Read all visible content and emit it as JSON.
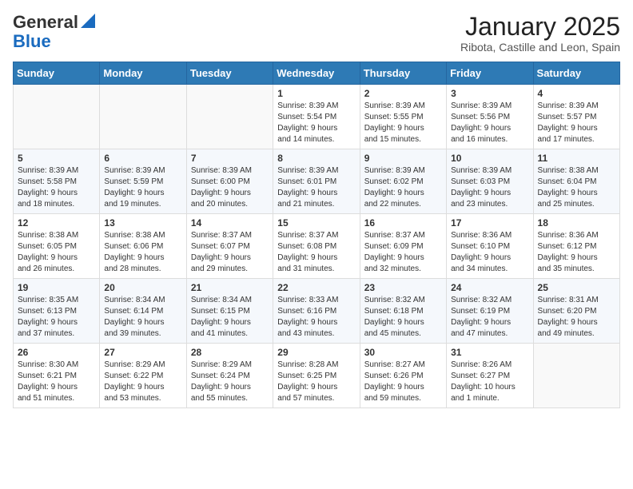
{
  "logo": {
    "general": "General",
    "blue": "Blue"
  },
  "title": "January 2025",
  "subtitle": "Ribota, Castille and Leon, Spain",
  "headers": [
    "Sunday",
    "Monday",
    "Tuesday",
    "Wednesday",
    "Thursday",
    "Friday",
    "Saturday"
  ],
  "weeks": [
    [
      {
        "day": "",
        "info": ""
      },
      {
        "day": "",
        "info": ""
      },
      {
        "day": "",
        "info": ""
      },
      {
        "day": "1",
        "info": "Sunrise: 8:39 AM\nSunset: 5:54 PM\nDaylight: 9 hours\nand 14 minutes."
      },
      {
        "day": "2",
        "info": "Sunrise: 8:39 AM\nSunset: 5:55 PM\nDaylight: 9 hours\nand 15 minutes."
      },
      {
        "day": "3",
        "info": "Sunrise: 8:39 AM\nSunset: 5:56 PM\nDaylight: 9 hours\nand 16 minutes."
      },
      {
        "day": "4",
        "info": "Sunrise: 8:39 AM\nSunset: 5:57 PM\nDaylight: 9 hours\nand 17 minutes."
      }
    ],
    [
      {
        "day": "5",
        "info": "Sunrise: 8:39 AM\nSunset: 5:58 PM\nDaylight: 9 hours\nand 18 minutes."
      },
      {
        "day": "6",
        "info": "Sunrise: 8:39 AM\nSunset: 5:59 PM\nDaylight: 9 hours\nand 19 minutes."
      },
      {
        "day": "7",
        "info": "Sunrise: 8:39 AM\nSunset: 6:00 PM\nDaylight: 9 hours\nand 20 minutes."
      },
      {
        "day": "8",
        "info": "Sunrise: 8:39 AM\nSunset: 6:01 PM\nDaylight: 9 hours\nand 21 minutes."
      },
      {
        "day": "9",
        "info": "Sunrise: 8:39 AM\nSunset: 6:02 PM\nDaylight: 9 hours\nand 22 minutes."
      },
      {
        "day": "10",
        "info": "Sunrise: 8:39 AM\nSunset: 6:03 PM\nDaylight: 9 hours\nand 23 minutes."
      },
      {
        "day": "11",
        "info": "Sunrise: 8:38 AM\nSunset: 6:04 PM\nDaylight: 9 hours\nand 25 minutes."
      }
    ],
    [
      {
        "day": "12",
        "info": "Sunrise: 8:38 AM\nSunset: 6:05 PM\nDaylight: 9 hours\nand 26 minutes."
      },
      {
        "day": "13",
        "info": "Sunrise: 8:38 AM\nSunset: 6:06 PM\nDaylight: 9 hours\nand 28 minutes."
      },
      {
        "day": "14",
        "info": "Sunrise: 8:37 AM\nSunset: 6:07 PM\nDaylight: 9 hours\nand 29 minutes."
      },
      {
        "day": "15",
        "info": "Sunrise: 8:37 AM\nSunset: 6:08 PM\nDaylight: 9 hours\nand 31 minutes."
      },
      {
        "day": "16",
        "info": "Sunrise: 8:37 AM\nSunset: 6:09 PM\nDaylight: 9 hours\nand 32 minutes."
      },
      {
        "day": "17",
        "info": "Sunrise: 8:36 AM\nSunset: 6:10 PM\nDaylight: 9 hours\nand 34 minutes."
      },
      {
        "day": "18",
        "info": "Sunrise: 8:36 AM\nSunset: 6:12 PM\nDaylight: 9 hours\nand 35 minutes."
      }
    ],
    [
      {
        "day": "19",
        "info": "Sunrise: 8:35 AM\nSunset: 6:13 PM\nDaylight: 9 hours\nand 37 minutes."
      },
      {
        "day": "20",
        "info": "Sunrise: 8:34 AM\nSunset: 6:14 PM\nDaylight: 9 hours\nand 39 minutes."
      },
      {
        "day": "21",
        "info": "Sunrise: 8:34 AM\nSunset: 6:15 PM\nDaylight: 9 hours\nand 41 minutes."
      },
      {
        "day": "22",
        "info": "Sunrise: 8:33 AM\nSunset: 6:16 PM\nDaylight: 9 hours\nand 43 minutes."
      },
      {
        "day": "23",
        "info": "Sunrise: 8:32 AM\nSunset: 6:18 PM\nDaylight: 9 hours\nand 45 minutes."
      },
      {
        "day": "24",
        "info": "Sunrise: 8:32 AM\nSunset: 6:19 PM\nDaylight: 9 hours\nand 47 minutes."
      },
      {
        "day": "25",
        "info": "Sunrise: 8:31 AM\nSunset: 6:20 PM\nDaylight: 9 hours\nand 49 minutes."
      }
    ],
    [
      {
        "day": "26",
        "info": "Sunrise: 8:30 AM\nSunset: 6:21 PM\nDaylight: 9 hours\nand 51 minutes."
      },
      {
        "day": "27",
        "info": "Sunrise: 8:29 AM\nSunset: 6:22 PM\nDaylight: 9 hours\nand 53 minutes."
      },
      {
        "day": "28",
        "info": "Sunrise: 8:29 AM\nSunset: 6:24 PM\nDaylight: 9 hours\nand 55 minutes."
      },
      {
        "day": "29",
        "info": "Sunrise: 8:28 AM\nSunset: 6:25 PM\nDaylight: 9 hours\nand 57 minutes."
      },
      {
        "day": "30",
        "info": "Sunrise: 8:27 AM\nSunset: 6:26 PM\nDaylight: 9 hours\nand 59 minutes."
      },
      {
        "day": "31",
        "info": "Sunrise: 8:26 AM\nSunset: 6:27 PM\nDaylight: 10 hours\nand 1 minute."
      },
      {
        "day": "",
        "info": ""
      }
    ]
  ]
}
